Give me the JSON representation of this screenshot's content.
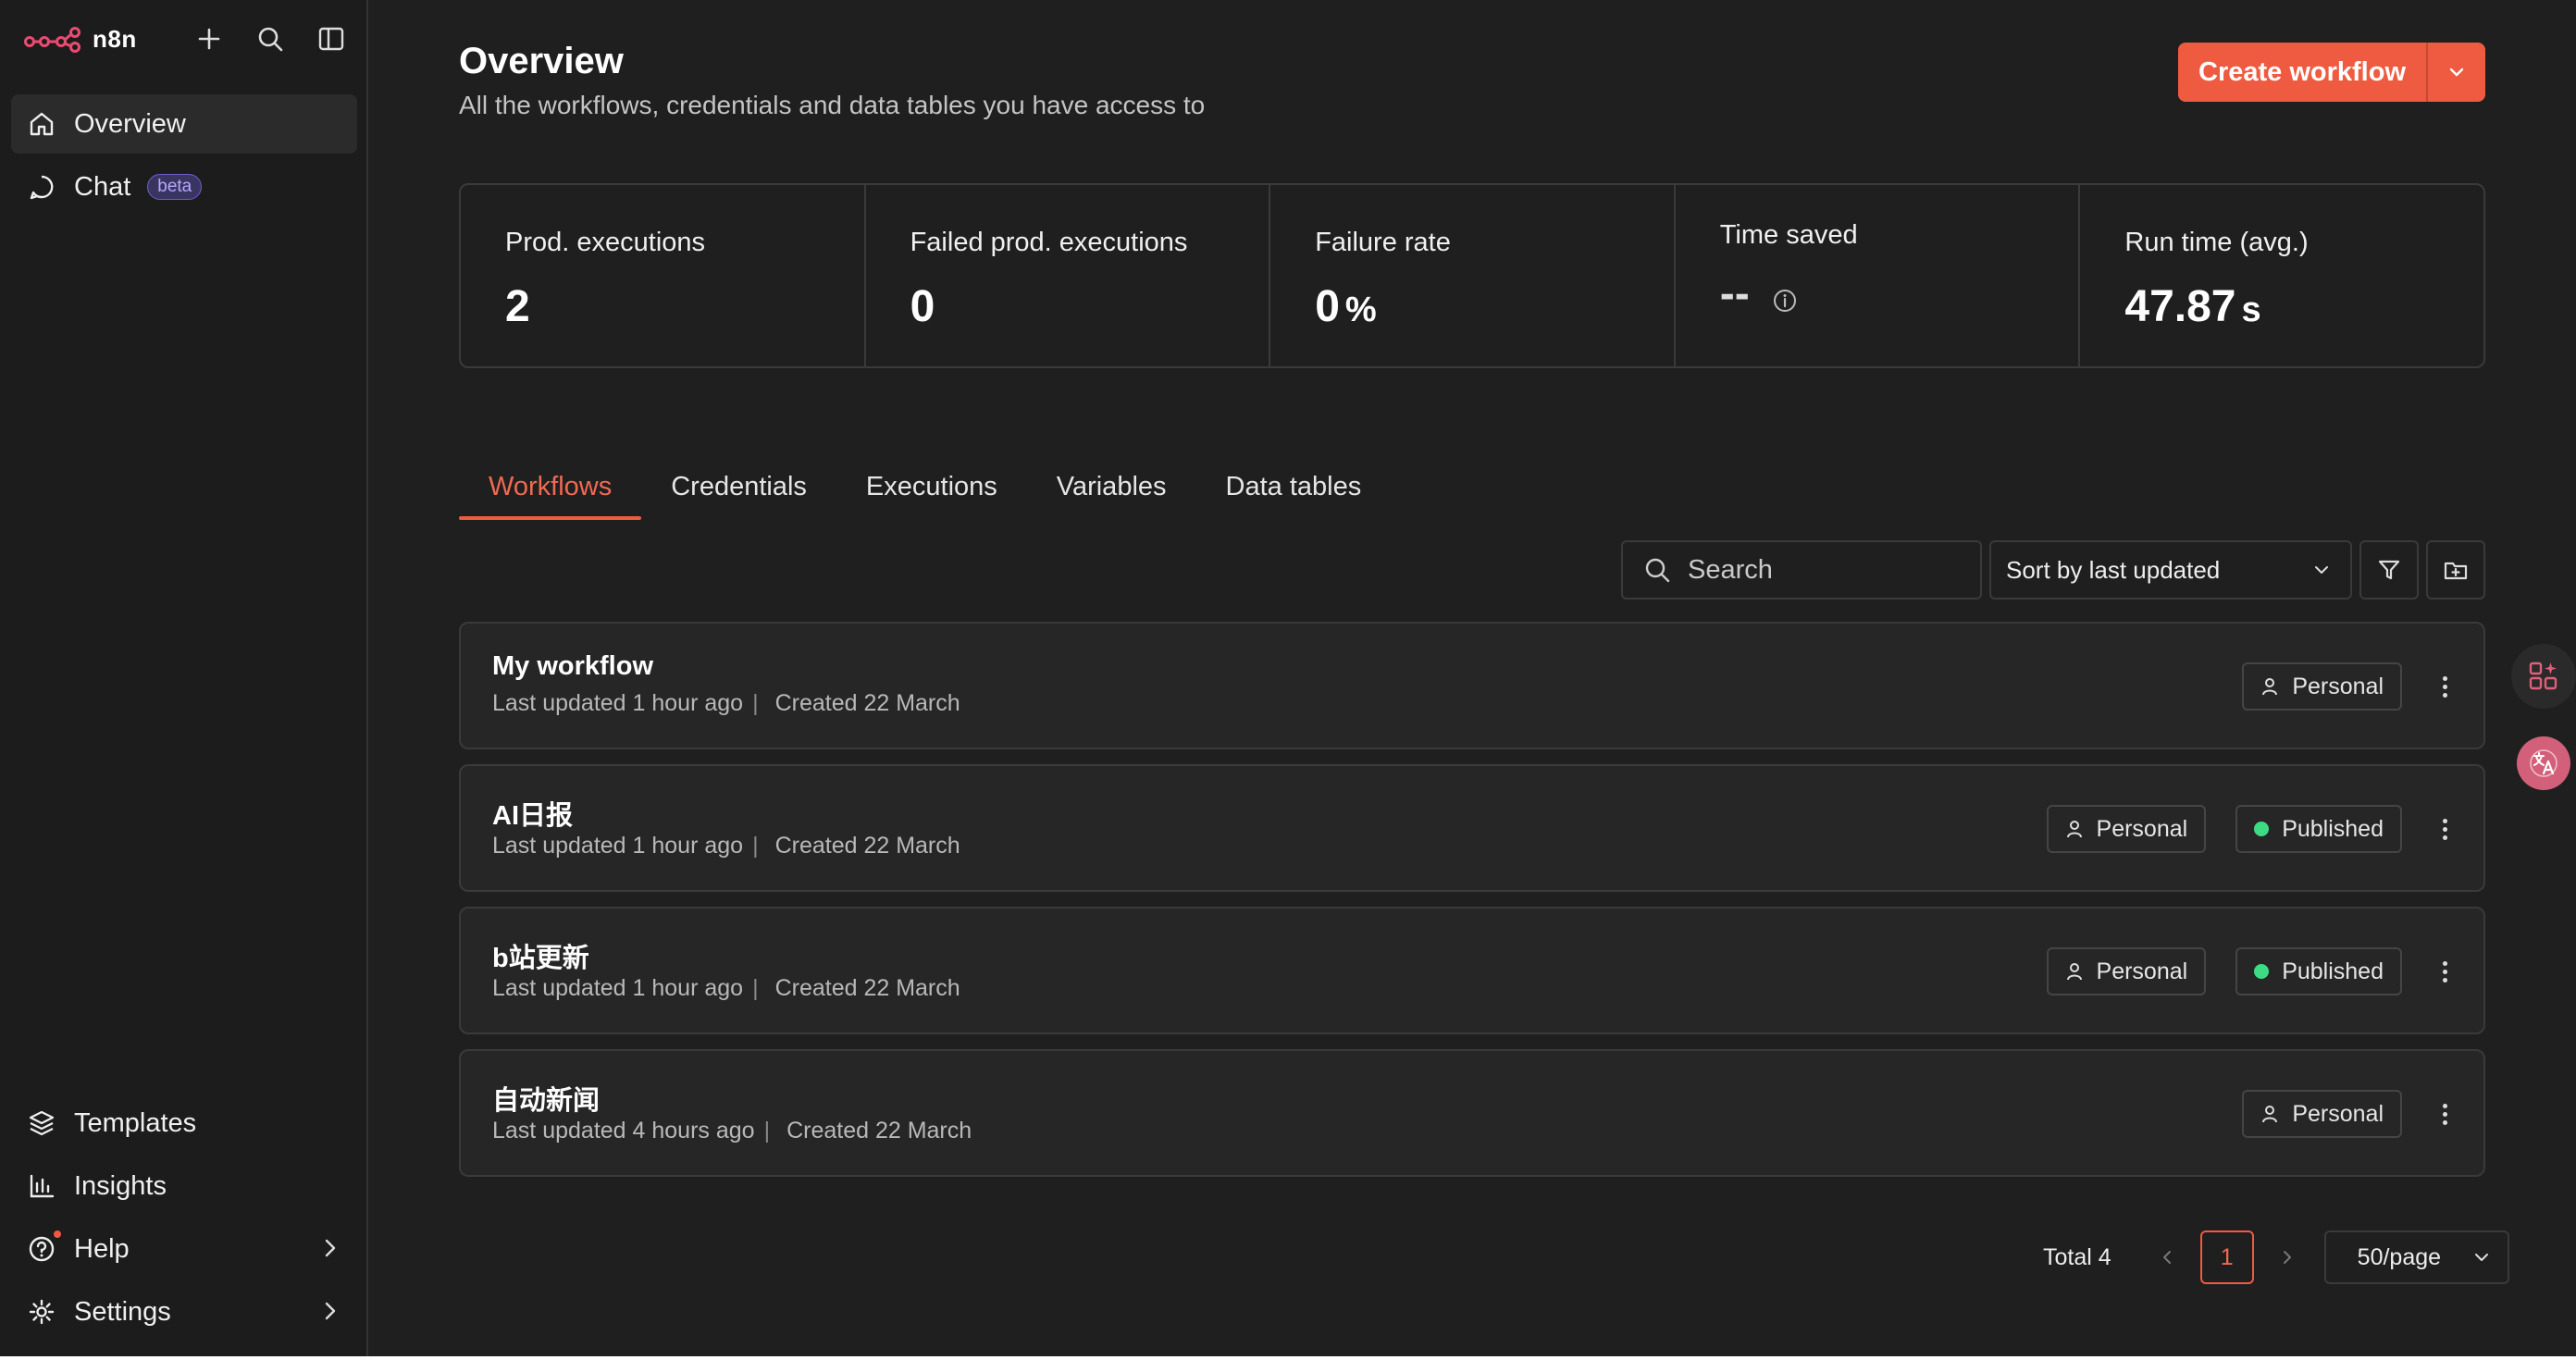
{
  "sidebar": {
    "brand": "n8n",
    "top_items": [
      {
        "label": "Overview",
        "icon": "home-icon",
        "active": true
      },
      {
        "label": "Chat",
        "icon": "chat-icon",
        "badge": "beta"
      }
    ],
    "bottom_items": [
      {
        "label": "Templates",
        "icon": "templates-icon"
      },
      {
        "label": "Insights",
        "icon": "insights-icon"
      },
      {
        "label": "Help",
        "icon": "help-icon"
      },
      {
        "label": "Settings",
        "icon": "settings-icon"
      }
    ]
  },
  "header": {
    "title": "Overview",
    "subtitle": "All the workflows, credentials and data tables you have access to",
    "create_label": "Create workflow"
  },
  "stats": [
    {
      "label": "Prod. executions",
      "value": "2",
      "unit": ""
    },
    {
      "label": "Failed prod. executions",
      "value": "0",
      "unit": ""
    },
    {
      "label": "Failure rate",
      "value": "0",
      "unit": "%"
    },
    {
      "label": "Time saved",
      "value": "--",
      "unit": ""
    },
    {
      "label": "Run time (avg.)",
      "value": "47.87",
      "unit": "s"
    }
  ],
  "tabs": [
    "Workflows",
    "Credentials",
    "Executions",
    "Variables",
    "Data tables"
  ],
  "active_tab": "Workflows",
  "toolbar": {
    "search_placeholder": "Search",
    "sort_label": "Sort by last updated"
  },
  "workflows": [
    {
      "name": "My workflow",
      "updated": "Last updated 1 hour ago",
      "created": "Created 22 March",
      "owner": "Personal",
      "status": ""
    },
    {
      "name": "AI日报",
      "updated": "Last updated 1 hour ago",
      "created": "Created 22 March",
      "owner": "Personal",
      "status": "Published"
    },
    {
      "name": "b站更新",
      "updated": "Last updated 1 hour ago",
      "created": "Created 22 March",
      "owner": "Personal",
      "status": "Published"
    },
    {
      "name": "自动新闻",
      "updated": "Last updated 4 hours ago",
      "created": "Created 22 March",
      "owner": "Personal",
      "status": ""
    }
  ],
  "pagination": {
    "total": "Total 4",
    "current_page": "1",
    "per_page": "50/page"
  },
  "colors": {
    "accent": "#ef5b41",
    "published": "#3ddc84",
    "background": "#1f1f1f"
  }
}
